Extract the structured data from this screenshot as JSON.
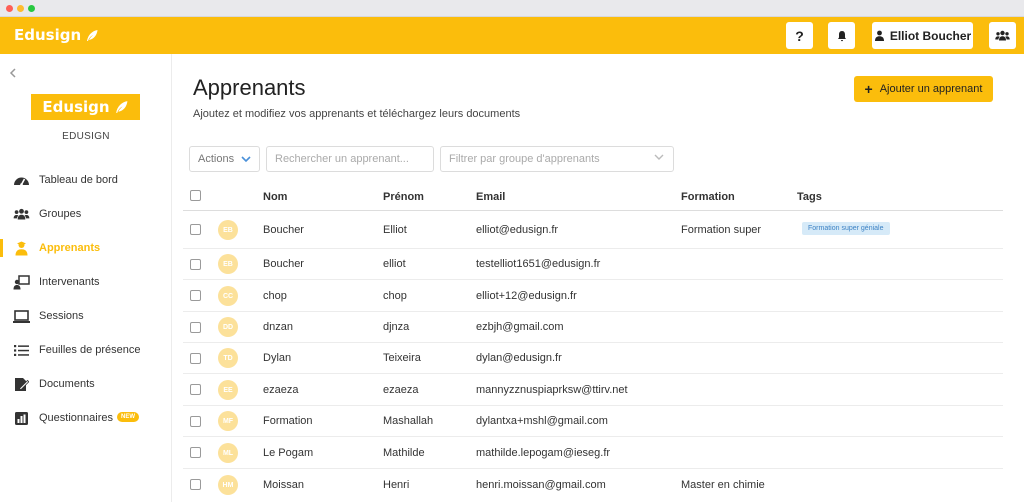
{
  "app": {
    "brand": "Edusign",
    "org_name": "EDUSIGN"
  },
  "topbar": {
    "help_label": "?",
    "user_name": "Elliot Boucher"
  },
  "sidebar": {
    "items": [
      {
        "label": "Tableau de bord",
        "icon": "dashboard-icon",
        "active": false
      },
      {
        "label": "Groupes",
        "icon": "groups-icon",
        "active": false
      },
      {
        "label": "Apprenants",
        "icon": "learner-icon",
        "active": true
      },
      {
        "label": "Intervenants",
        "icon": "speaker-icon",
        "active": false
      },
      {
        "label": "Sessions",
        "icon": "laptop-icon",
        "active": false
      },
      {
        "label": "Feuilles de présence",
        "icon": "list-icon",
        "active": false
      },
      {
        "label": "Documents",
        "icon": "document-icon",
        "active": false
      },
      {
        "label": "Questionnaires",
        "icon": "chart-icon",
        "active": false,
        "badge": "NEW"
      }
    ]
  },
  "main": {
    "title": "Apprenants",
    "subtitle": "Ajoutez et modifiez vos apprenants et téléchargez leurs documents",
    "add_button": "Ajouter un apprenant",
    "actions_label": "Actions",
    "search_placeholder": "Rechercher un apprenant...",
    "group_filter_placeholder": "Filtrer par groupe d'apprenants"
  },
  "table": {
    "headers": {
      "nom": "Nom",
      "prenom": "Prénom",
      "email": "Email",
      "formation": "Formation",
      "tags": "Tags"
    },
    "rows": [
      {
        "initials": "EB",
        "nom": "Boucher",
        "prenom": "Elliot",
        "email": "elliot@edusign.fr",
        "formation": "Formation super",
        "tag": "Formation super géniale"
      },
      {
        "initials": "EB",
        "nom": "Boucher",
        "prenom": "elliot",
        "email": "testelliot1651@edusign.fr",
        "formation": "",
        "tag": ""
      },
      {
        "initials": "CC",
        "nom": "chop",
        "prenom": "chop",
        "email": "elliot+12@edusign.fr",
        "formation": "",
        "tag": ""
      },
      {
        "initials": "DD",
        "nom": "dnzan",
        "prenom": "djnza",
        "email": "ezbjh@gmail.com",
        "formation": "",
        "tag": ""
      },
      {
        "initials": "TD",
        "nom": "Dylan",
        "prenom": "Teixeira",
        "email": "dylan@edusign.fr",
        "formation": "",
        "tag": ""
      },
      {
        "initials": "EE",
        "nom": "ezaeza",
        "prenom": "ezaeza",
        "email": "mannyzznuspiaprksw@ttirv.net",
        "formation": "",
        "tag": ""
      },
      {
        "initials": "MF",
        "nom": "Formation",
        "prenom": "Mashallah",
        "email": "dylantxa+mshl@gmail.com",
        "formation": "",
        "tag": ""
      },
      {
        "initials": "ML",
        "nom": "Le Pogam",
        "prenom": "Mathilde",
        "email": "mathilde.lepogam@ieseg.fr",
        "formation": "",
        "tag": ""
      },
      {
        "initials": "HM",
        "nom": "Moissan",
        "prenom": "Henri",
        "email": "henri.moissan@gmail.com",
        "formation": "Master en chimie",
        "tag": ""
      }
    ]
  },
  "colors": {
    "brand": "#fbbd0c",
    "avatar": "#fce19a",
    "tag_bg": "#d6eaf8",
    "tag_text": "#3d82c4"
  }
}
